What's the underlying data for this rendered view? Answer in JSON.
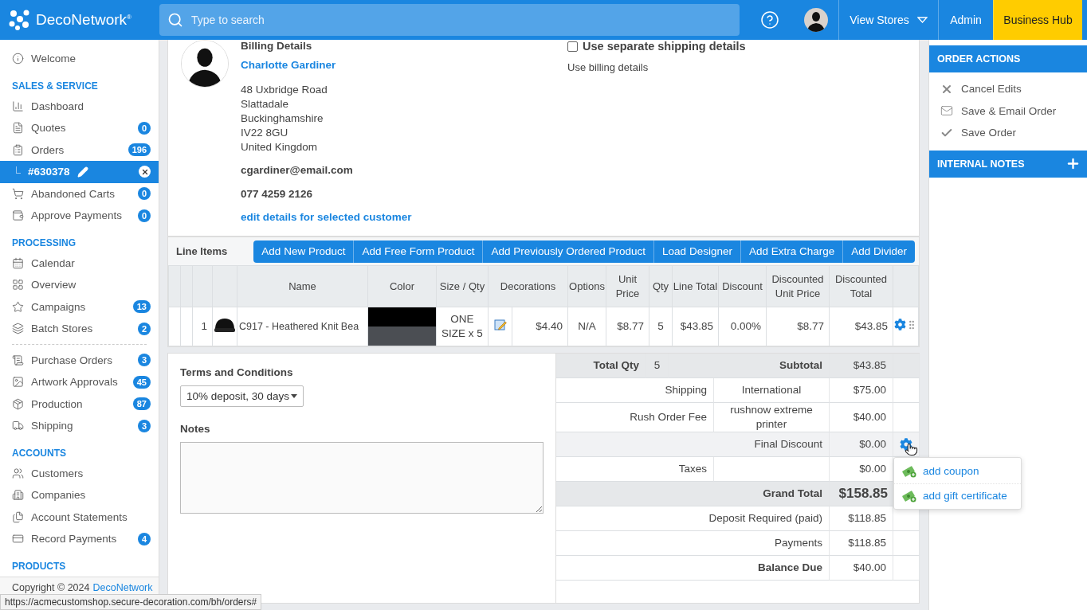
{
  "topbar": {
    "logo": "DecoNetwork$^{®}$",
    "search": {
      "placeholder": "Type to search"
    },
    "menu": [
      {
        "kind": "dropdown",
        "label": "View Stores"
      },
      {
        "kind": "link",
        "label": "Admin"
      },
      {
        "kind": "highlight",
        "label": "Business Hub"
      }
    ]
  },
  "sidebar": {
    "items": [
      {
        "kind": "item",
        "label": "Welcome",
        "selected": false
      },
      {
        "kind": "heading",
        "label": "SALES & SERVICE"
      },
      {
        "kind": "item",
        "label": "Dashboard",
        "selected": false
      },
      {
        "kind": "item",
        "label": "Quotes",
        "badge": "0",
        "selected": false
      },
      {
        "kind": "item",
        "label": "Orders",
        "badge": "196",
        "selected": false
      },
      {
        "kind": "subitem",
        "label": "#630378",
        "selected": true
      },
      {
        "kind": "item",
        "label": "Abandoned Carts",
        "badge": "0",
        "selected": false
      },
      {
        "kind": "item",
        "label": "Approve Payments",
        "badge": "0",
        "selected": false
      },
      {
        "kind": "heading",
        "label": "PROCESSING"
      },
      {
        "kind": "item",
        "label": "Calendar",
        "selected": false
      },
      {
        "kind": "item",
        "label": "Overview",
        "selected": false
      },
      {
        "kind": "item",
        "label": "Campaigns",
        "badge": "13",
        "selected": false
      },
      {
        "kind": "item",
        "label": "Batch Stores",
        "badge": "2",
        "selected": false
      },
      {
        "kind": "divider"
      },
      {
        "kind": "item",
        "label": "Purchase Orders",
        "badge": "3",
        "selected": false
      },
      {
        "kind": "item",
        "label": "Artwork Approvals",
        "badge": "45",
        "selected": false
      },
      {
        "kind": "item",
        "label": "Production",
        "badge": "87",
        "selected": false
      },
      {
        "kind": "item",
        "label": "Shipping",
        "badge": "3",
        "selected": false
      },
      {
        "kind": "heading",
        "label": "ACCOUNTS"
      },
      {
        "kind": "item",
        "label": "Customers",
        "selected": false
      },
      {
        "kind": "item",
        "label": "Companies",
        "selected": false
      },
      {
        "kind": "item",
        "label": "Account Statements",
        "selected": false
      },
      {
        "kind": "item",
        "label": "Record Payments",
        "badge": "4",
        "selected": false
      },
      {
        "kind": "heading",
        "label": "PRODUCTS"
      }
    ],
    "copyright": "Copyright © 2024",
    "copyright_link": "DecoNetwork"
  },
  "billing": {
    "title": "Billing Details",
    "name": "Charlotte Gardiner",
    "address": [
      "48 Uxbridge Road",
      "Slattadale",
      "Buckinghamshire",
      "IV22 8GU",
      "United Kingdom"
    ],
    "email": "cgardiner@email.com",
    "phone": "077 4259 2126",
    "edit_link": "edit details for selected customer"
  },
  "shipping": {
    "checkbox": {
      "label": "Use separate shipping details",
      "checked": false
    },
    "note": "Use billing details"
  },
  "line_items": {
    "title": "Line Items",
    "buttons": [
      "Add New Product",
      "Add Free Form Product",
      "Add Previously Ordered Product",
      "Load Designer",
      "Add Extra Charge",
      "Add Divider"
    ],
    "columns": [
      "Name",
      "Color",
      "Size / Qty",
      "Decorations",
      "Options",
      "Unit Price",
      "Qty",
      "Line Total",
      "Discount",
      "Discounted Unit Price",
      "Discounted Total"
    ],
    "rows": [
      {
        "number": "1",
        "name": "C917 - Heathered Knit Bea",
        "size_qty": "ONE SIZE x 5",
        "decoration_price": "$4.40",
        "options": "N/A",
        "unit_price": "$8.77",
        "qty": "5",
        "line_total": "$43.85",
        "discount": "0.00%",
        "discounted_unit_price": "$8.77",
        "discounted_total": "$43.85"
      }
    ]
  },
  "terms": {
    "label": "Terms and Conditions",
    "value": "10% deposit, 30 days"
  },
  "notes": {
    "label": "Notes"
  },
  "totals": [
    {
      "kind": "summary",
      "label": "Total Qty",
      "qty": "5",
      "label2": "Subtotal",
      "value": "$43.85"
    },
    {
      "kind": "fee",
      "label": "Shipping",
      "detail": "International",
      "value": "$75.00"
    },
    {
      "kind": "fee",
      "label": "Rush Order Fee",
      "detail": "rushnow extreme printer",
      "value": "$40.00"
    },
    {
      "kind": "discount",
      "label": "Final Discount",
      "value": "$0.00"
    },
    {
      "kind": "fee",
      "label": "Taxes",
      "value": "$0.00"
    },
    {
      "kind": "total",
      "label": "Grand Total",
      "value": "$158.85"
    },
    {
      "kind": "line",
      "label": "Deposit Required (paid)",
      "value": "$118.85",
      "bold": false
    },
    {
      "kind": "line",
      "label": "Payments",
      "value": "$118.85",
      "bold": false
    },
    {
      "kind": "line",
      "label": "Balance Due",
      "value": "$40.00",
      "bold": true
    }
  ],
  "discount_menu": [
    "add coupon",
    "add gift certificate"
  ],
  "right_panel": {
    "order_actions": {
      "title": "ORDER ACTIONS",
      "items": [
        "Cancel Edits",
        "Save & Email Order",
        "Save Order"
      ]
    },
    "internal_notes": {
      "title": "INTERNAL NOTES"
    }
  },
  "status_bar": "https://acmecustomshop.secure-decoration.com/bh/orders#"
}
